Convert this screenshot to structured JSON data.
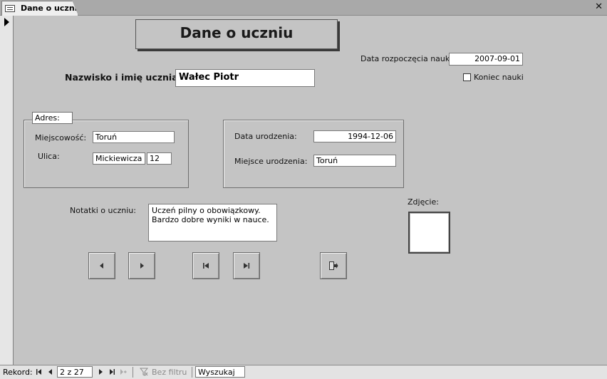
{
  "window": {
    "tab_title": "Dane o uczniu",
    "close_glyph": "✕"
  },
  "form": {
    "title": "Dane o uczniu",
    "start_date_label": "Data rozpoczęcia nauki:",
    "start_date_value": "2007-09-01",
    "end_label": "Koniec nauki",
    "end_checked": false,
    "name_label": "Nazwisko i imię ucznia:",
    "name_value": "Wałec Piotr",
    "address": {
      "caption": "Adres:",
      "city_label": "Miejscowość:",
      "city_value": "Toruń",
      "street_label": "Ulica:",
      "street_value": "Mickiewicza",
      "house_value": "12"
    },
    "birth": {
      "date_label": "Data urodzenia:",
      "date_value": "1994-12-06",
      "place_label": "Miejsce urodzenia:",
      "place_value": "Toruń"
    },
    "notes_label": "Notatki o uczniu:",
    "notes_value": "Uczeń pilny o obowiązkowy.\nBardzo dobre wyniki w nauce.",
    "photo_label": "Zdjęcie:"
  },
  "buttons": [
    {
      "name": "previous-record-button",
      "icon": "triangle-left-icon"
    },
    {
      "name": "next-record-button",
      "icon": "triangle-right-icon"
    },
    {
      "name": "first-record-button",
      "icon": "first-record-icon"
    },
    {
      "name": "last-record-button",
      "icon": "last-record-icon"
    },
    {
      "name": "close-form-button",
      "icon": "exit-door-icon"
    }
  ],
  "statusbar": {
    "record_label": "Rekord:",
    "record_value": "2 z 27",
    "filter_label": "Bez filtru",
    "search_label": "Wyszukaj"
  },
  "colors": {
    "form_bg": "#c4c4c4",
    "tabbar_bg": "#a9a9a9",
    "status_bg": "#e3e3e3"
  }
}
